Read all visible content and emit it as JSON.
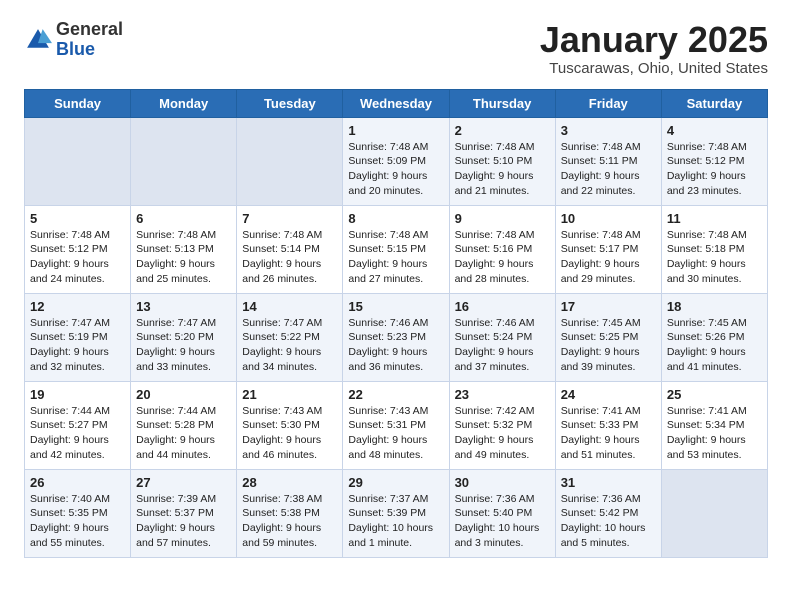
{
  "header": {
    "logo_general": "General",
    "logo_blue": "Blue",
    "title": "January 2025",
    "subtitle": "Tuscarawas, Ohio, United States"
  },
  "weekdays": [
    "Sunday",
    "Monday",
    "Tuesday",
    "Wednesday",
    "Thursday",
    "Friday",
    "Saturday"
  ],
  "weeks": [
    [
      {
        "day": "",
        "empty": true
      },
      {
        "day": "",
        "empty": true
      },
      {
        "day": "",
        "empty": true
      },
      {
        "day": "1",
        "sunrise": "7:48 AM",
        "sunset": "5:09 PM",
        "daylight": "9 hours and 20 minutes."
      },
      {
        "day": "2",
        "sunrise": "7:48 AM",
        "sunset": "5:10 PM",
        "daylight": "9 hours and 21 minutes."
      },
      {
        "day": "3",
        "sunrise": "7:48 AM",
        "sunset": "5:11 PM",
        "daylight": "9 hours and 22 minutes."
      },
      {
        "day": "4",
        "sunrise": "7:48 AM",
        "sunset": "5:12 PM",
        "daylight": "9 hours and 23 minutes."
      }
    ],
    [
      {
        "day": "5",
        "sunrise": "7:48 AM",
        "sunset": "5:12 PM",
        "daylight": "9 hours and 24 minutes."
      },
      {
        "day": "6",
        "sunrise": "7:48 AM",
        "sunset": "5:13 PM",
        "daylight": "9 hours and 25 minutes."
      },
      {
        "day": "7",
        "sunrise": "7:48 AM",
        "sunset": "5:14 PM",
        "daylight": "9 hours and 26 minutes."
      },
      {
        "day": "8",
        "sunrise": "7:48 AM",
        "sunset": "5:15 PM",
        "daylight": "9 hours and 27 minutes."
      },
      {
        "day": "9",
        "sunrise": "7:48 AM",
        "sunset": "5:16 PM",
        "daylight": "9 hours and 28 minutes."
      },
      {
        "day": "10",
        "sunrise": "7:48 AM",
        "sunset": "5:17 PM",
        "daylight": "9 hours and 29 minutes."
      },
      {
        "day": "11",
        "sunrise": "7:48 AM",
        "sunset": "5:18 PM",
        "daylight": "9 hours and 30 minutes."
      }
    ],
    [
      {
        "day": "12",
        "sunrise": "7:47 AM",
        "sunset": "5:19 PM",
        "daylight": "9 hours and 32 minutes."
      },
      {
        "day": "13",
        "sunrise": "7:47 AM",
        "sunset": "5:20 PM",
        "daylight": "9 hours and 33 minutes."
      },
      {
        "day": "14",
        "sunrise": "7:47 AM",
        "sunset": "5:22 PM",
        "daylight": "9 hours and 34 minutes."
      },
      {
        "day": "15",
        "sunrise": "7:46 AM",
        "sunset": "5:23 PM",
        "daylight": "9 hours and 36 minutes."
      },
      {
        "day": "16",
        "sunrise": "7:46 AM",
        "sunset": "5:24 PM",
        "daylight": "9 hours and 37 minutes."
      },
      {
        "day": "17",
        "sunrise": "7:45 AM",
        "sunset": "5:25 PM",
        "daylight": "9 hours and 39 minutes."
      },
      {
        "day": "18",
        "sunrise": "7:45 AM",
        "sunset": "5:26 PM",
        "daylight": "9 hours and 41 minutes."
      }
    ],
    [
      {
        "day": "19",
        "sunrise": "7:44 AM",
        "sunset": "5:27 PM",
        "daylight": "9 hours and 42 minutes."
      },
      {
        "day": "20",
        "sunrise": "7:44 AM",
        "sunset": "5:28 PM",
        "daylight": "9 hours and 44 minutes."
      },
      {
        "day": "21",
        "sunrise": "7:43 AM",
        "sunset": "5:30 PM",
        "daylight": "9 hours and 46 minutes."
      },
      {
        "day": "22",
        "sunrise": "7:43 AM",
        "sunset": "5:31 PM",
        "daylight": "9 hours and 48 minutes."
      },
      {
        "day": "23",
        "sunrise": "7:42 AM",
        "sunset": "5:32 PM",
        "daylight": "9 hours and 49 minutes."
      },
      {
        "day": "24",
        "sunrise": "7:41 AM",
        "sunset": "5:33 PM",
        "daylight": "9 hours and 51 minutes."
      },
      {
        "day": "25",
        "sunrise": "7:41 AM",
        "sunset": "5:34 PM",
        "daylight": "9 hours and 53 minutes."
      }
    ],
    [
      {
        "day": "26",
        "sunrise": "7:40 AM",
        "sunset": "5:35 PM",
        "daylight": "9 hours and 55 minutes."
      },
      {
        "day": "27",
        "sunrise": "7:39 AM",
        "sunset": "5:37 PM",
        "daylight": "9 hours and 57 minutes."
      },
      {
        "day": "28",
        "sunrise": "7:38 AM",
        "sunset": "5:38 PM",
        "daylight": "9 hours and 59 minutes."
      },
      {
        "day": "29",
        "sunrise": "7:37 AM",
        "sunset": "5:39 PM",
        "daylight": "10 hours and 1 minute."
      },
      {
        "day": "30",
        "sunrise": "7:36 AM",
        "sunset": "5:40 PM",
        "daylight": "10 hours and 3 minutes."
      },
      {
        "day": "31",
        "sunrise": "7:36 AM",
        "sunset": "5:42 PM",
        "daylight": "10 hours and 5 minutes."
      },
      {
        "day": "",
        "empty": true
      }
    ]
  ]
}
